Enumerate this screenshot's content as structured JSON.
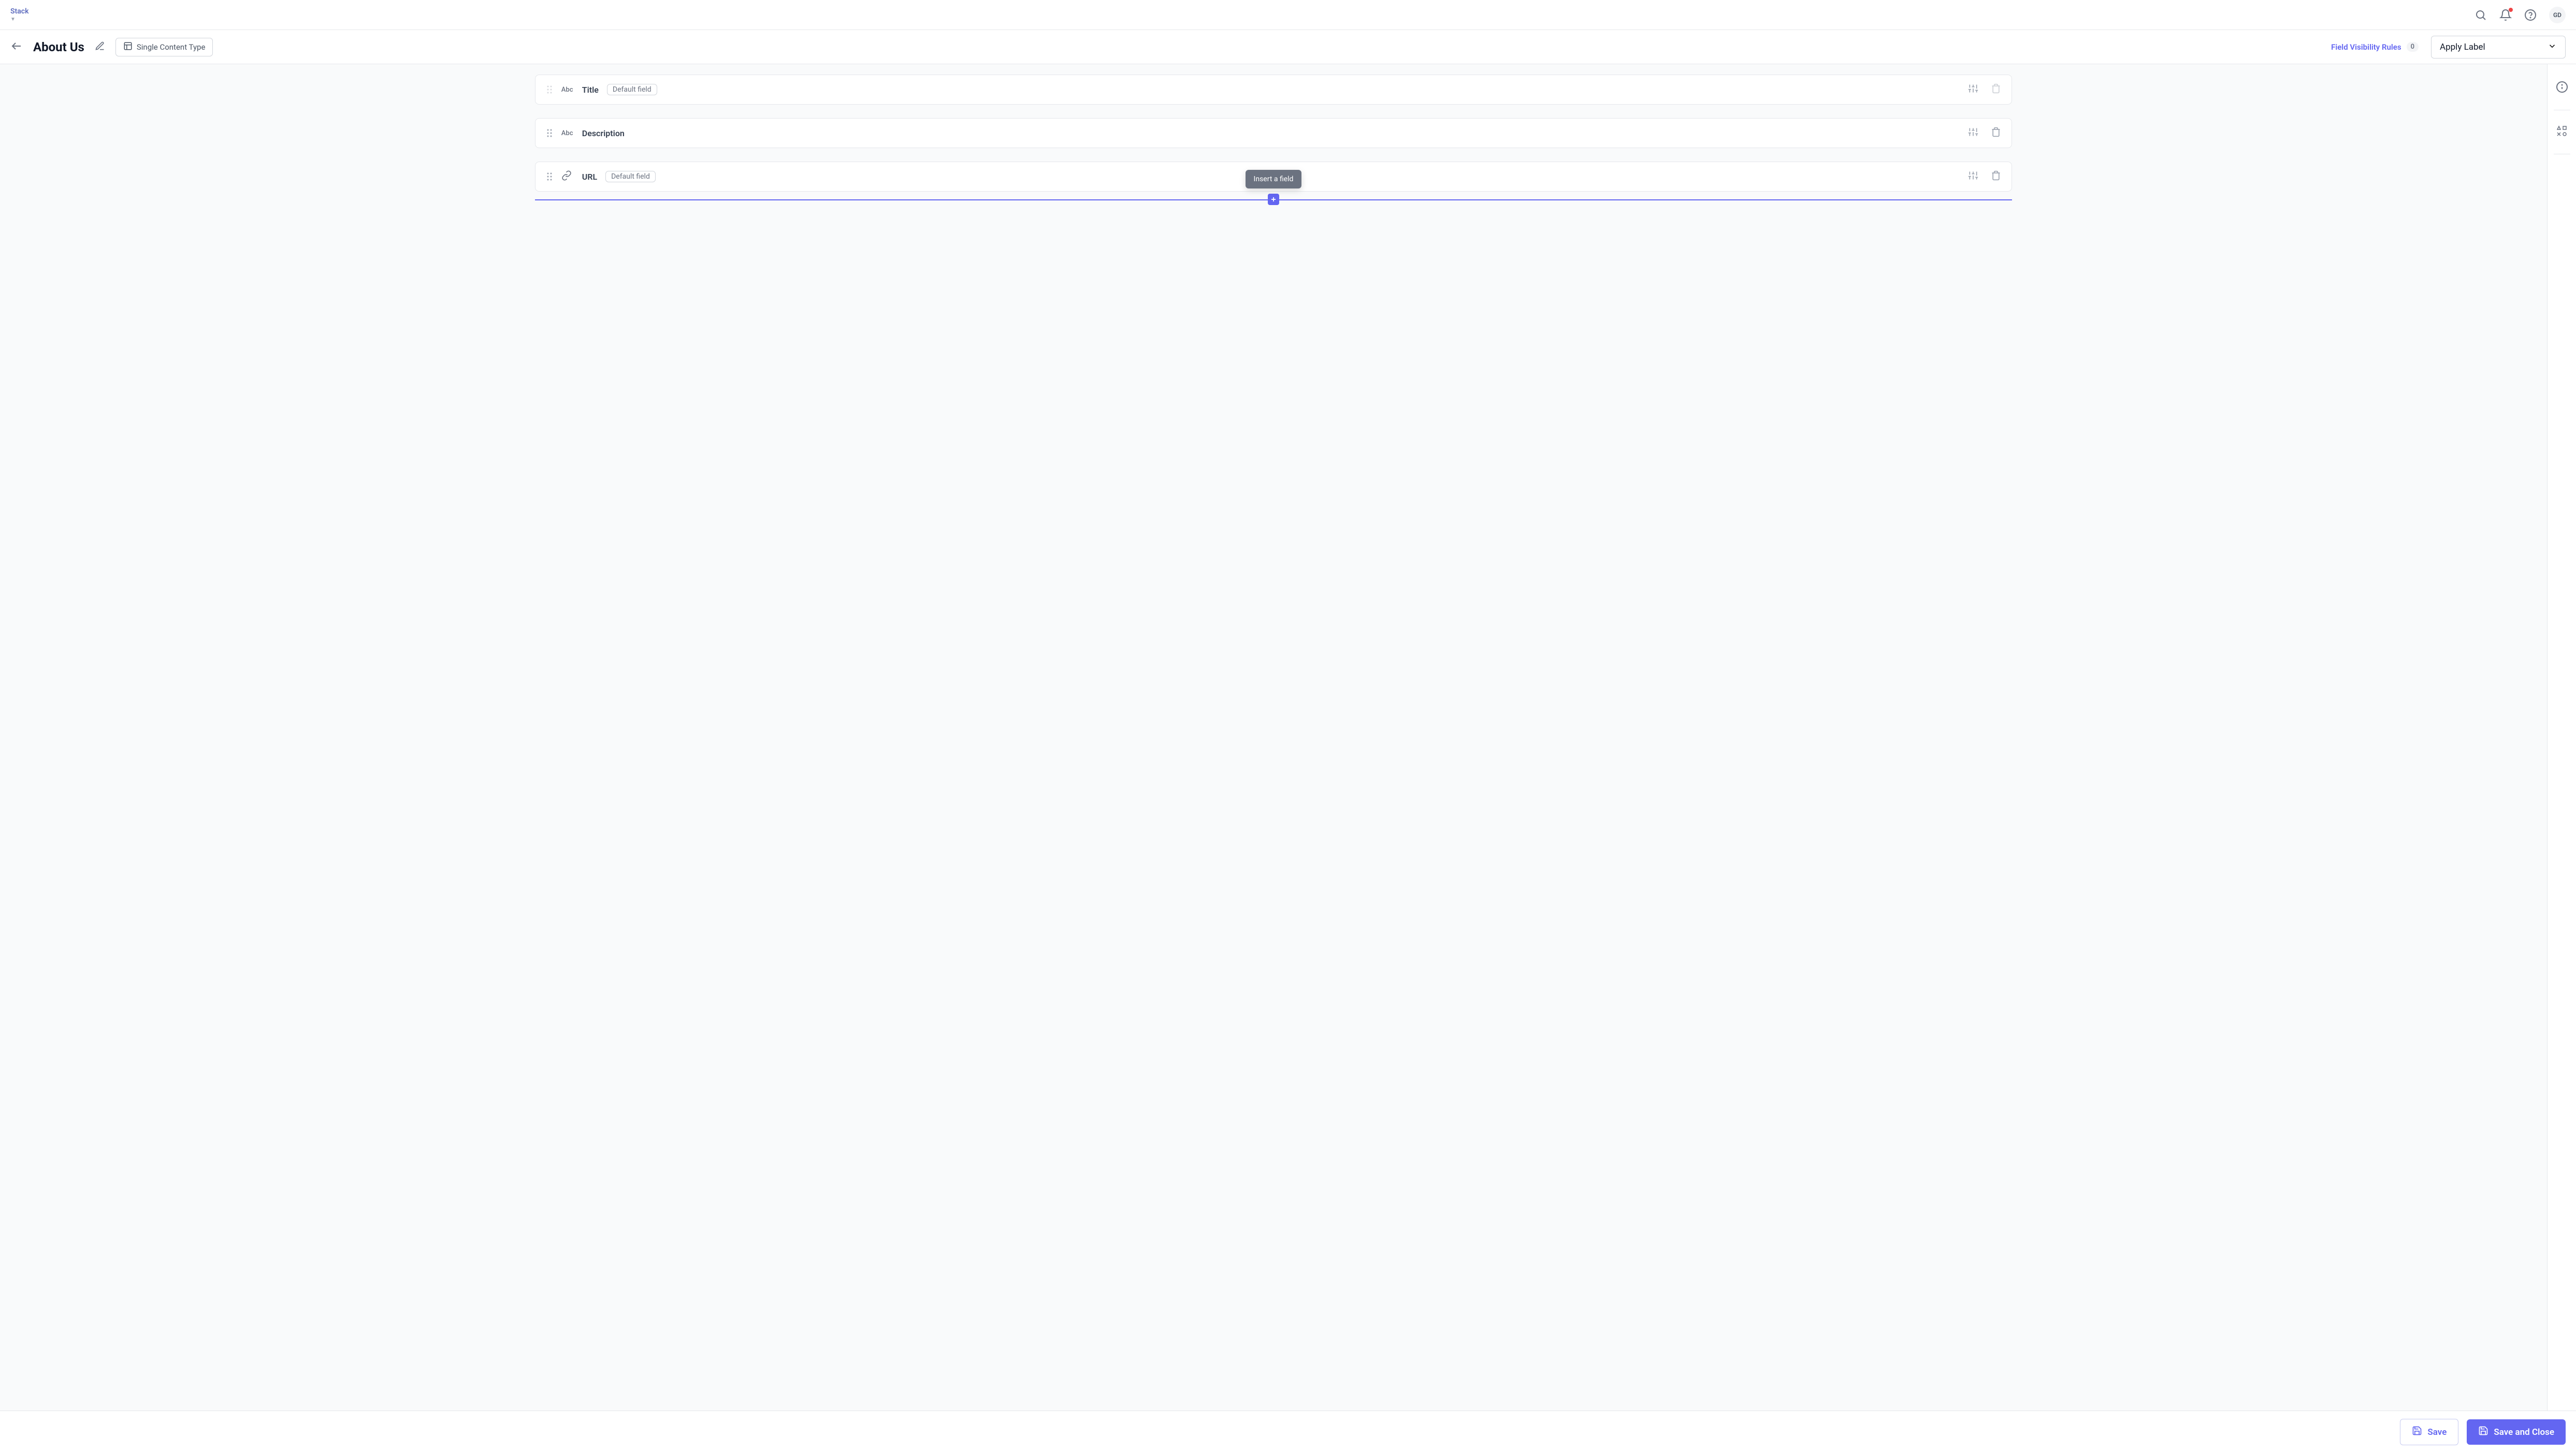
{
  "header": {
    "stack_label": "Stack",
    "avatar_initials": "GD"
  },
  "subheader": {
    "title": "About Us",
    "content_type_label": "Single Content Type",
    "visibility_rules_label": "Field Visibility Rules",
    "visibility_rules_count": "0",
    "apply_label": "Apply Label"
  },
  "fields": [
    {
      "name": "Title",
      "type_label": "Abc",
      "default_badge": "Default field",
      "has_default_badge": true,
      "drag_disabled": true,
      "delete_disabled": true,
      "icon_type": "text"
    },
    {
      "name": "Description",
      "type_label": "Abc",
      "has_default_badge": false,
      "drag_disabled": false,
      "delete_disabled": false,
      "icon_type": "text"
    },
    {
      "name": "URL",
      "default_badge": "Default field",
      "has_default_badge": true,
      "drag_disabled": false,
      "delete_disabled": false,
      "icon_type": "link"
    }
  ],
  "insert": {
    "tooltip": "Insert a field"
  },
  "footer": {
    "save_label": "Save",
    "save_close_label": "Save and Close"
  }
}
